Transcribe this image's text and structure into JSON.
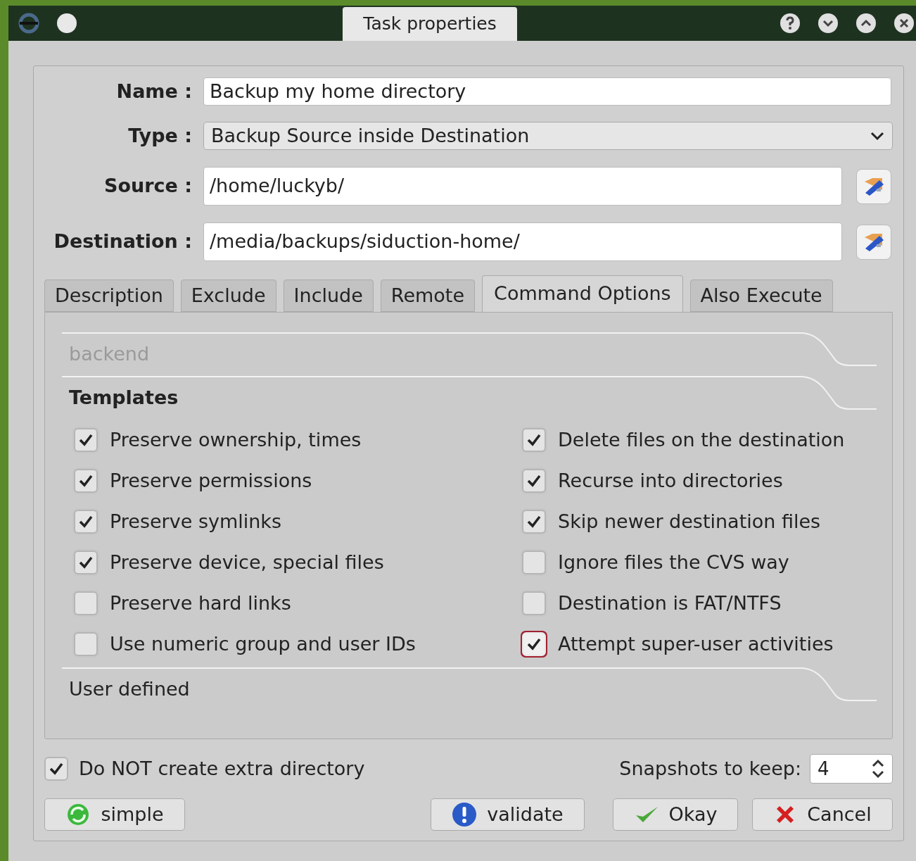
{
  "window": {
    "title": "Task properties"
  },
  "fields": [
    {
      "label": "Name :",
      "value": "Backup my home directory",
      "kind": "text"
    },
    {
      "label": "Type :",
      "value": "Backup Source inside Destination",
      "kind": "dropdown"
    },
    {
      "label": "Source :",
      "value": "/home/luckyb/",
      "kind": "path"
    },
    {
      "label": "Destination :",
      "value": "/media/backups/siduction-home/",
      "kind": "path"
    }
  ],
  "tabs": [
    {
      "label": "Description",
      "selected": false
    },
    {
      "label": "Exclude",
      "selected": false
    },
    {
      "label": "Include",
      "selected": false
    },
    {
      "label": "Remote",
      "selected": false
    },
    {
      "label": "Command Options",
      "selected": true
    },
    {
      "label": "Also Execute",
      "selected": false
    }
  ],
  "sections": [
    {
      "title": "backend",
      "disabled": true,
      "expanded": false
    },
    {
      "title": "Templates",
      "disabled": false,
      "expanded": true,
      "columns": [
        {
          "options": [
            {
              "label": "Preserve ownership, times",
              "checked": true,
              "focused": false
            },
            {
              "label": "Preserve permissions",
              "checked": true,
              "focused": false
            },
            {
              "label": "Preserve symlinks",
              "checked": true,
              "focused": false
            },
            {
              "label": "Preserve device, special files",
              "checked": true,
              "focused": false
            },
            {
              "label": "Preserve hard links",
              "checked": false,
              "focused": false
            },
            {
              "label": "Use numeric group and user IDs",
              "checked": false,
              "focused": false
            }
          ]
        },
        {
          "options": [
            {
              "label": "Delete files on the destination",
              "checked": true,
              "focused": false
            },
            {
              "label": "Recurse into directories",
              "checked": true,
              "focused": false
            },
            {
              "label": "Skip newer destination files",
              "checked": true,
              "focused": false
            },
            {
              "label": "Ignore files the CVS way",
              "checked": false,
              "focused": false
            },
            {
              "label": "Destination is FAT/NTFS",
              "checked": false,
              "focused": false
            },
            {
              "label": "Attempt super-user activities",
              "checked": true,
              "focused": true
            }
          ]
        }
      ]
    },
    {
      "title": "User defined",
      "disabled": false,
      "expanded": false
    }
  ],
  "extra_directory": {
    "label": "Do NOT create extra directory",
    "checked": true
  },
  "snapshots": {
    "label": "Snapshots to keep:",
    "value": "4"
  },
  "buttons": [
    {
      "label": "simple",
      "kind": "mode"
    },
    {
      "label": "validate",
      "kind": "validate"
    },
    {
      "label": "Okay",
      "kind": "ok"
    },
    {
      "label": "Cancel",
      "kind": "cancel"
    }
  ]
}
